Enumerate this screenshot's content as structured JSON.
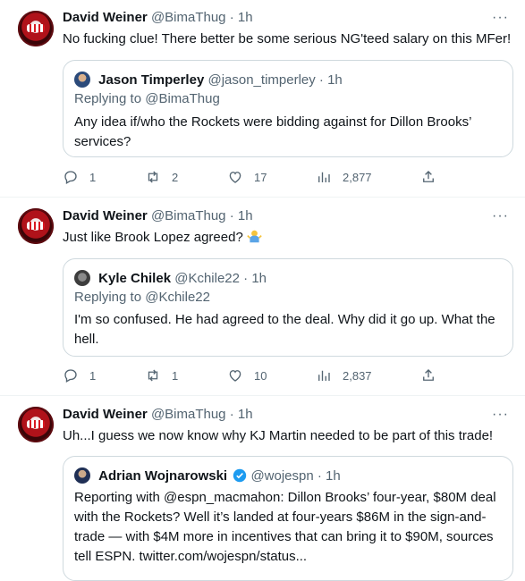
{
  "tweets": [
    {
      "author": "David Weiner",
      "handle": "@BimaThug",
      "sep": "·",
      "time": "1h",
      "text": "No fucking clue! There better be some serious NG'teed salary on this MFer!",
      "quote": {
        "author": "Jason Timperley",
        "handle": "@jason_timperley",
        "time": "1h",
        "reply": "Replying to @BimaThug",
        "text": "Any idea if/who the Rockets were bidding against for Dillon Brooks’ services?"
      },
      "stats": {
        "replies": "1",
        "retweets": "2",
        "likes": "17",
        "views": "2,877"
      }
    },
    {
      "author": "David Weiner",
      "handle": "@BimaThug",
      "sep": "·",
      "time": "1h",
      "text": "Just like Brook Lopez agreed?",
      "quote": {
        "author": "Kyle Chilek",
        "handle": "@Kchile22",
        "time": "1h",
        "reply": "Replying to @Kchile22",
        "text": "I'm so confused. He had agreed to the deal. Why did it go up. What the hell."
      },
      "stats": {
        "replies": "1",
        "retweets": "1",
        "likes": "10",
        "views": "2,837"
      }
    },
    {
      "author": "David Weiner",
      "handle": "@BimaThug",
      "sep": "·",
      "time": "1h",
      "text": "Uh...I guess we now know why KJ Martin needed to be part of this trade!",
      "quote": {
        "author": "Adrian Wojnarowski",
        "handle": "@wojespn",
        "time": "1h",
        "text": "Reporting with @espn_macmahon: Dillon Brooks’ four-year, $80M deal with the Rockets? Well it’s landed at four-years $86M in the sign-and-trade — with $4M more in incentives that can bring it to $90M, sources tell ESPN. twitter.com/wojespn/status..."
      }
    }
  ],
  "icons": {
    "more": "more-icon",
    "reply": "reply-icon",
    "retweet": "retweet-icon",
    "like": "like-icon",
    "views": "views-icon",
    "share": "share-icon",
    "verified": "verified-badge-icon",
    "emoji": "person-shrugging-emoji"
  },
  "colors": {
    "text": "#0f1419",
    "muted": "#536471",
    "border": "#cfd9de",
    "verified": "#1d9bf0",
    "avatar": "#b0121a"
  }
}
